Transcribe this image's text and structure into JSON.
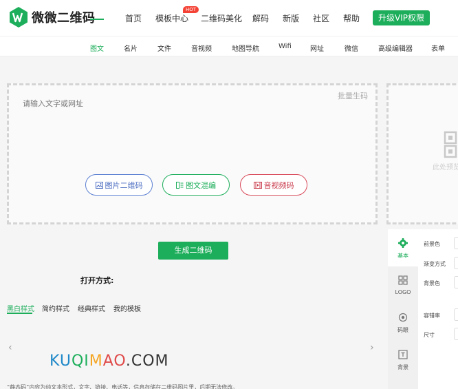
{
  "brand": {
    "name": "微微二维码",
    "accent": "#1dae5b"
  },
  "nav": {
    "items": [
      "首页",
      "模板中心",
      "二维码美化",
      "解码",
      "新版",
      "社区",
      "帮助"
    ],
    "hot_badge": "HOT",
    "vip_label": "升级VIP权限"
  },
  "subnav": {
    "items": [
      "图文",
      "名片",
      "文件",
      "音视频",
      "地图导航",
      "Wifi",
      "网址",
      "微信",
      "高级编辑器",
      "表单"
    ],
    "active": "图文"
  },
  "editor": {
    "placeholder": "请输入文字或网址",
    "batch_label": "批量生码",
    "buttons": [
      "图片二维码",
      "图文混编",
      "音视频码"
    ]
  },
  "preview": {
    "text": "此处预览"
  },
  "generate_label": "生成二维码",
  "open_mode_label": "打开方式:",
  "style_tabs": [
    "黑白样式",
    "简约样式",
    "经典样式",
    "我的模板"
  ],
  "carousel": {
    "logo_text": [
      "KU",
      "QI",
      "M",
      "AO",
      ".COM"
    ],
    "description": "“静态码”内容为纯文本形式，文字、链接、电话等，信息存储在二维码图片里，后期无法修改。"
  },
  "side_panel": {
    "tabs": [
      "基本",
      "LOGO",
      "码眼",
      "背景"
    ],
    "active_tab": "基本",
    "options": [
      "前景色",
      "渐变方式",
      "背景色",
      "容错率",
      "尺寸"
    ]
  }
}
